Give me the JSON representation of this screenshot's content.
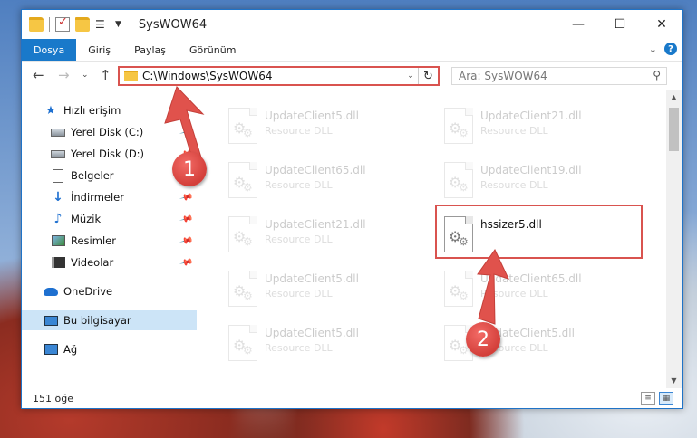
{
  "window": {
    "title": "SysWOW64",
    "controls": {
      "minimize": "—",
      "maximize": "☐",
      "close": "✕"
    }
  },
  "ribbon": {
    "tabs": [
      {
        "label": "Dosya",
        "active": true
      },
      {
        "label": "Giriş",
        "active": false
      },
      {
        "label": "Paylaş",
        "active": false
      },
      {
        "label": "Görünüm",
        "active": false
      }
    ],
    "help": "?"
  },
  "nav": {
    "address": "C:\\Windows\\SysWOW64",
    "search_placeholder": "Ara: SysWOW64"
  },
  "sidebar": {
    "items": [
      {
        "label": "Hızlı erişim",
        "icon": "star-icon"
      },
      {
        "label": "Yerel Disk (C:)",
        "icon": "drive-icon",
        "pinned": true
      },
      {
        "label": "Yerel Disk (D:)",
        "icon": "drive-icon",
        "pinned": true
      },
      {
        "label": "Belgeler",
        "icon": "document-icon",
        "pinned": true
      },
      {
        "label": "İndirmeler",
        "icon": "download-icon",
        "pinned": true
      },
      {
        "label": "Müzik",
        "icon": "music-icon",
        "pinned": true
      },
      {
        "label": "Resimler",
        "icon": "pictures-icon",
        "pinned": true
      },
      {
        "label": "Videolar",
        "icon": "videos-icon",
        "pinned": true
      },
      {
        "label": "OneDrive",
        "icon": "cloud-icon"
      },
      {
        "label": "Bu bilgisayar",
        "icon": "computer-icon",
        "selected": true
      },
      {
        "label": "Ağ",
        "icon": "network-icon"
      }
    ]
  },
  "files": [
    {
      "name": "UpdateClient5.dll",
      "type": "Resource DLL",
      "faded": true
    },
    {
      "name": "UpdateClient21.dll",
      "type": "Resource DLL",
      "faded": true
    },
    {
      "name": "UpdateClient65.dll",
      "type": "Resource DLL",
      "faded": true
    },
    {
      "name": "UpdateClient19.dll",
      "type": "Resource DLL",
      "faded": true
    },
    {
      "name": "UpdateClient21.dll",
      "type": "Resource DLL",
      "faded": true
    },
    {
      "name": "hssizer5.dll",
      "type": "",
      "faded": false
    },
    {
      "name": "UpdateClient5.dll",
      "type": "Resource DLL",
      "faded": true
    },
    {
      "name": "UpdateClient65.dll",
      "type": "Resource DLL",
      "faded": true
    },
    {
      "name": "UpdateClient5.dll",
      "type": "Resource DLL",
      "faded": true
    },
    {
      "name": "UpdateClient5.dll",
      "type": "Resource DLL",
      "faded": true
    }
  ],
  "status": {
    "count": "151 öğe"
  },
  "annotations": {
    "badge1": "1",
    "badge2": "2",
    "color": "#d9534f"
  }
}
